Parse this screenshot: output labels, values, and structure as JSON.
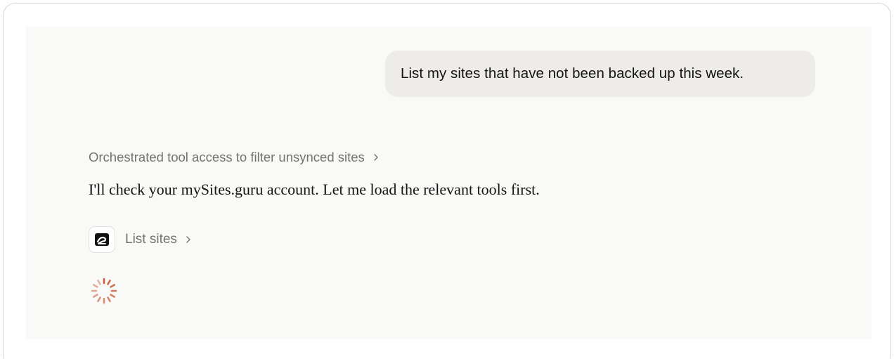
{
  "conversation": {
    "user_message": "List my sites that have not been backed up this week.",
    "thinking_summary": "Orchestrated tool access to filter unsynced sites",
    "assistant_message": "I'll check your mySites.guru account. Let me load the relevant tools first.",
    "tool_call": {
      "label": "List sites",
      "icon": "mysites-guru-logo-icon"
    },
    "status": {
      "icon": "loading-spinner-icon"
    }
  },
  "colors": {
    "panel_background": "#f9f9f8",
    "user_bubble": "#eeecea",
    "muted_text": "#75736d",
    "primary_text": "#141413",
    "spinner_accent": "#c96442"
  }
}
